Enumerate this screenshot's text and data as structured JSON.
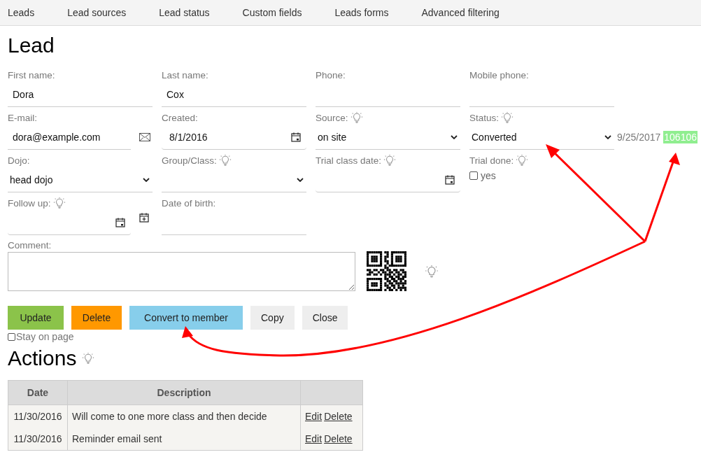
{
  "nav": [
    {
      "label": "Leads"
    },
    {
      "label": "Lead sources"
    },
    {
      "label": "Lead status"
    },
    {
      "label": "Custom fields"
    },
    {
      "label": "Leads forms"
    },
    {
      "label": "Advanced filtering"
    }
  ],
  "title": "Lead",
  "fields": [
    {
      "kind": "text",
      "label": "First name:",
      "value": "Dora",
      "help": false
    },
    {
      "kind": "text",
      "label": "Last name:",
      "value": "Cox",
      "help": false
    },
    {
      "kind": "text",
      "label": "Phone:",
      "help": false
    },
    {
      "kind": "text",
      "label": "Mobile phone:",
      "help": false
    },
    {
      "kind": "email",
      "label": "E-mail:",
      "value": "dora@example.com",
      "help": false
    },
    {
      "kind": "date",
      "label": "Created:",
      "value": "8/1/2016",
      "help": false,
      "add_button": false
    },
    {
      "kind": "select",
      "label": "Source:",
      "value": "on site",
      "help": true
    },
    {
      "kind": "select",
      "label": "Status:",
      "value": "Converted",
      "help": true,
      "note": "9/25/2017",
      "badge": "106106"
    },
    {
      "kind": "select",
      "label": "Dojo:",
      "value": "head dojo",
      "help": false
    },
    {
      "kind": "select",
      "label": "Group/Class:",
      "help": true
    },
    {
      "kind": "date",
      "label": "Trial class date:",
      "help": true,
      "add_button": false
    },
    {
      "kind": "checkbox",
      "label": "Trial done:",
      "option": "yes",
      "checked": false,
      "help": true
    },
    {
      "kind": "date",
      "label": "Follow up:",
      "help": true,
      "add_button": true
    },
    {
      "kind": "text",
      "label": "Date of birth:",
      "help": false
    }
  ],
  "comment": {
    "label": "Comment:"
  },
  "buttons": [
    {
      "label": "Update",
      "kind": "update"
    },
    {
      "label": "Delete",
      "kind": "delete"
    },
    {
      "label": "Convert to member",
      "kind": "convert"
    },
    {
      "label": "Copy",
      "kind": "plain"
    },
    {
      "label": "Close",
      "kind": "plain"
    }
  ],
  "stay_on_page": {
    "label": "Stay on page",
    "checked": false
  },
  "actions": {
    "title": "Actions",
    "columns": [
      "Date",
      "Description"
    ],
    "rows": [
      {
        "date": "11/30/2016",
        "description": "Will come to one more class and then decide",
        "links": [
          "Edit",
          "Delete"
        ]
      },
      {
        "date": "11/30/2016",
        "description": "Reminder email sent",
        "links": [
          "Edit",
          "Delete"
        ]
      }
    ]
  }
}
